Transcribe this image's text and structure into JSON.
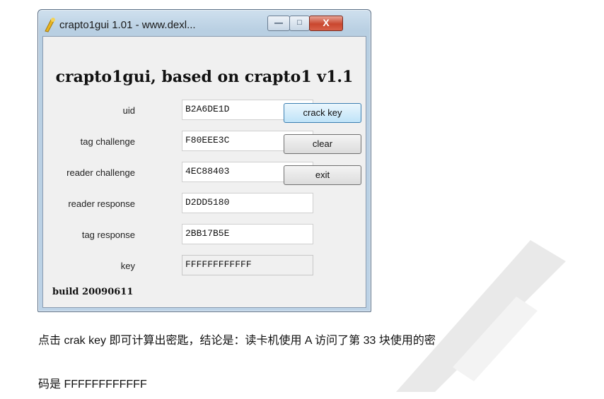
{
  "window": {
    "title": "crapto1gui 1.01 - www.dexl...",
    "controls": {
      "minimize": "—",
      "maximize": "□",
      "close": "X"
    }
  },
  "app": {
    "heading": "crapto1gui, based on crapto1 v1.1",
    "fields": [
      {
        "label": "uid",
        "value": "B2A6DE1D"
      },
      {
        "label": "tag challenge",
        "value": "F80EEE3C"
      },
      {
        "label": "reader challenge",
        "value": "4EC88403"
      },
      {
        "label": "reader response",
        "value": "D2DD5180"
      },
      {
        "label": "tag response",
        "value": "2BB17B5E"
      },
      {
        "label": "key",
        "value": "FFFFFFFFFFFF"
      }
    ],
    "buttons": {
      "crack": "crack key",
      "clear": "clear",
      "exit": "exit"
    },
    "build": "build 20090611"
  },
  "caption": {
    "line1": "点击 crak key 即可计算出密匙，结论是：读卡机使用 A 访问了第 33 块使用的密",
    "line2": "码是 FFFFFFFFFFFF"
  },
  "colors": {
    "close_button": "#c9472f",
    "watermark": "#e6e6e6"
  }
}
